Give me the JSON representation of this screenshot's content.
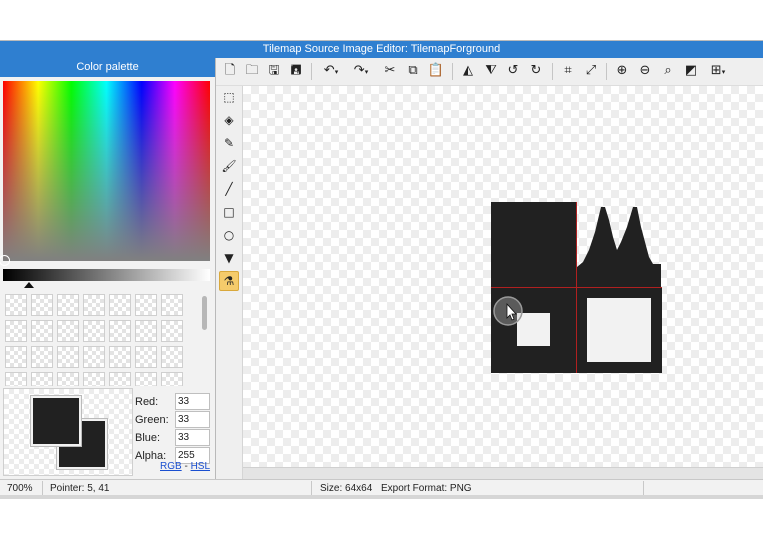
{
  "window": {
    "title": "Tilemap Source Image Editor: TilemapForground",
    "accent": "#2f7fd0"
  },
  "palette": {
    "title": "Color palette",
    "channels": [
      {
        "label": "Red:",
        "value": "33"
      },
      {
        "label": "Green:",
        "value": "33"
      },
      {
        "label": "Blue:",
        "value": "33"
      },
      {
        "label": "Alpha:",
        "value": "255"
      }
    ],
    "mode_rgb": "RGB",
    "mode_sep": " - ",
    "mode_hsl": "HSL",
    "primary_color": "#212121",
    "secondary_color": "#212121"
  },
  "toolbar": {
    "icons": [
      "new-file-icon",
      "open-folder-icon",
      "save-icon",
      "save-as-icon",
      "undo-icon",
      "redo-icon",
      "cut-icon",
      "copy-icon",
      "paste-icon",
      "flip-horizontal-icon",
      "flip-vertical-icon",
      "rotate-left-icon",
      "rotate-right-icon",
      "crop-icon",
      "resize-icon",
      "zoom-in-icon",
      "zoom-out-icon",
      "zoom-fit-icon",
      "invert-colors-icon",
      "grid-icon"
    ]
  },
  "tools": {
    "items": [
      "select-icon",
      "eraser-icon",
      "pencil-icon",
      "brush-icon",
      "line-icon",
      "rectangle-icon",
      "ellipse-icon",
      "fill-bucket-icon",
      "eyedropper-icon"
    ],
    "active": "eyedropper-icon"
  },
  "status": {
    "zoom": "700%",
    "pointer": "Pointer: 5, 41",
    "size": "Size: 64x64",
    "format": "Export Format: PNG"
  }
}
